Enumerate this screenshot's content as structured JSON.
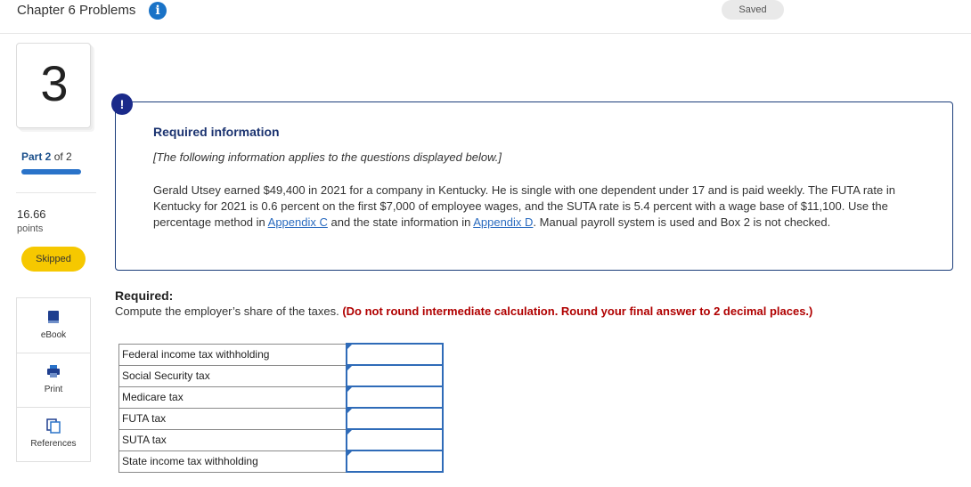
{
  "header": {
    "title": "Chapter 6 Problems",
    "saved_label": "Saved"
  },
  "sidebar": {
    "question_number": "3",
    "part_current": "Part 2",
    "part_total": "of 2",
    "points_value": "16.66",
    "points_label": "points",
    "status_label": "Skipped",
    "tools": [
      {
        "label": "eBook",
        "icon": "book-icon"
      },
      {
        "label": "Print",
        "icon": "printer-icon"
      },
      {
        "label": "References",
        "icon": "references-icon"
      }
    ]
  },
  "info": {
    "badge": "!",
    "title": "Required information",
    "note": "[The following information applies to the questions displayed below.]",
    "text_1": "Gerald Utsey earned $49,400 in 2021 for a company in Kentucky. He is single with one dependent under 17 and is paid weekly. The FUTA rate in Kentucky for 2021 is 0.6 percent on the first $7,000 of employee wages, and the SUTA rate is 5.4 percent with a wage base of $11,100. Use the percentage method in ",
    "link_1": "Appendix C",
    "text_2": " and the state information in ",
    "link_2": "Appendix D",
    "text_3": ". Manual payroll system is used and Box 2 is not checked."
  },
  "required": {
    "title": "Required:",
    "text": "Compute the employer’s share of the taxes.",
    "emphasis": "(Do not round intermediate calculation. Round your final answer to 2 decimal places.)"
  },
  "table": {
    "rows": [
      {
        "label": "Federal income tax withholding",
        "value": ""
      },
      {
        "label": "Social Security tax",
        "value": ""
      },
      {
        "label": "Medicare tax",
        "value": ""
      },
      {
        "label": "FUTA tax",
        "value": ""
      },
      {
        "label": "SUTA tax",
        "value": ""
      },
      {
        "label": "State income tax withholding",
        "value": ""
      }
    ]
  },
  "colors": {
    "accent": "#1a73c7",
    "navy": "#1b3370",
    "skipped": "#f6c800",
    "warning_red": "#b00000"
  }
}
